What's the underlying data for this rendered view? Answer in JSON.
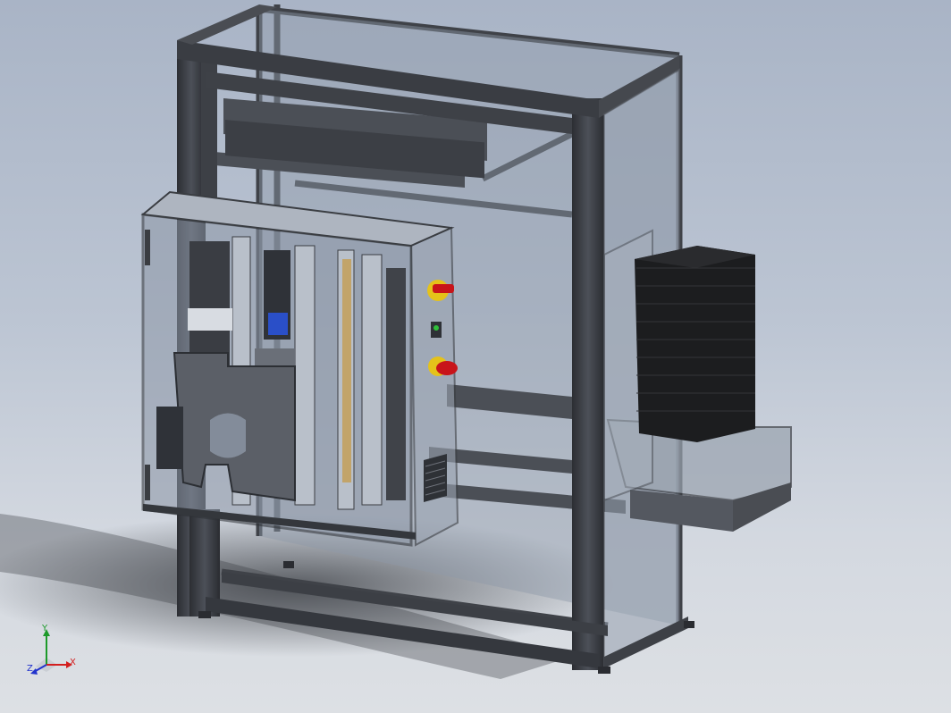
{
  "viewport": {
    "background_top": "#a9b4c6",
    "background_bottom": "#dde0e4"
  },
  "model": {
    "frame_color": "#3a3d42",
    "panel_tint": "#7f8a99",
    "stack_color": "#1c1d1f",
    "estop_color": "#c8141a",
    "yellow_collar": "#e5c21a",
    "indicator_green": "#2fbf3a",
    "indicator_blue": "#2a4fc8",
    "icons": [
      "machine-frame",
      "electrical-cabinet",
      "emergency-stop-icon",
      "selector-switch-icon",
      "indicator-light-icon",
      "vent-grille-icon",
      "part-stack-icon",
      "adjustable-foot-icon"
    ]
  },
  "triad": {
    "x_label": "X",
    "y_label": "Y",
    "z_label": "Z",
    "x_color": "#d31f1f",
    "y_color": "#1d9a2a",
    "z_color": "#2233cc"
  }
}
